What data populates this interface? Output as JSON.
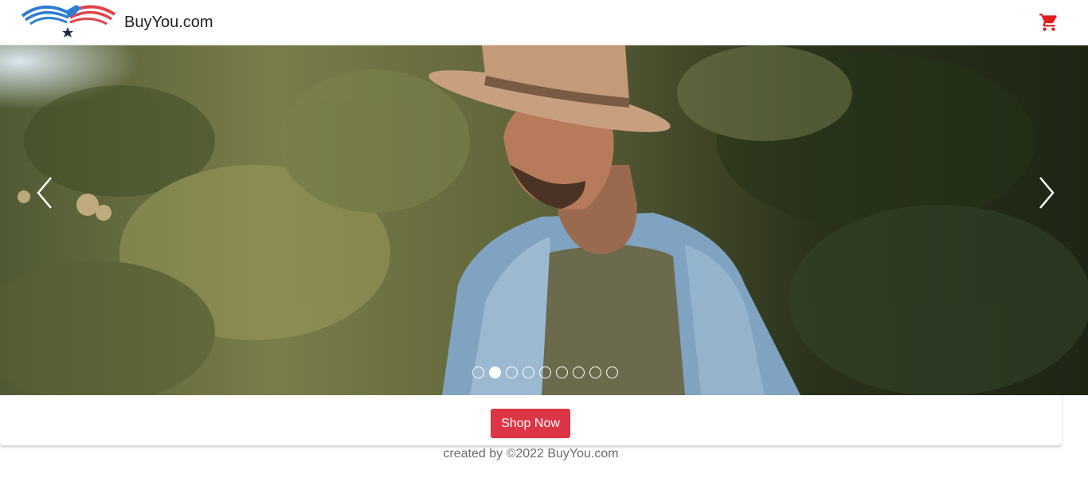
{
  "navbar": {
    "brand_name": "BuyYou.com",
    "logo_icon": "eagle-flag-logo",
    "cart_icon": "shopping-cart-icon",
    "cart_color": "#e01e1e"
  },
  "carousel": {
    "image": "man-in-hat-and-denim-jacket-photo",
    "prev_icon": "chevron-left-icon",
    "next_icon": "chevron-right-icon",
    "slide_count": 9,
    "active_slide": 2
  },
  "cta": {
    "label": "Shop Now",
    "color": "#dc3545"
  },
  "footer": {
    "text": "created by ©2022 BuyYou.com"
  }
}
